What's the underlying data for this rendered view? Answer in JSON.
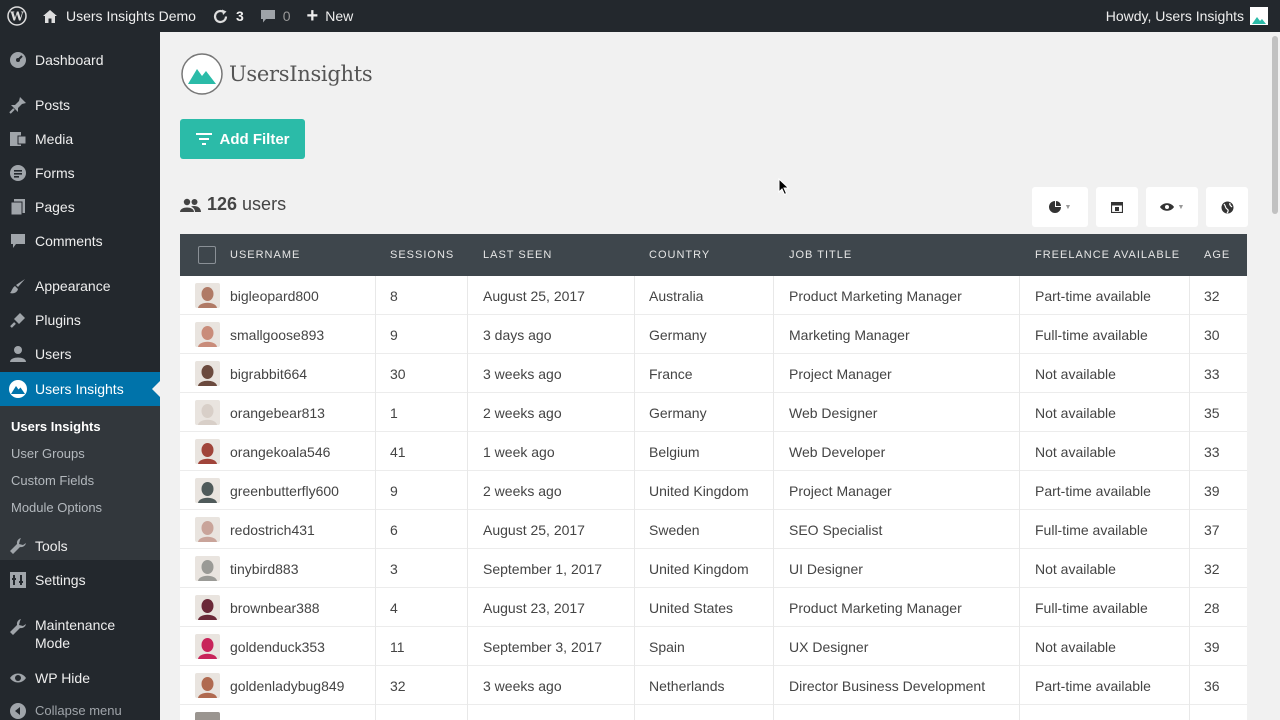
{
  "admin_bar": {
    "site_name": "Users Insights Demo",
    "updates_count": "3",
    "comments_count": "0",
    "new_label": "New",
    "greeting": "Howdy, Users Insights"
  },
  "sidebar": {
    "items": [
      {
        "label": "Dashboard",
        "icon": "dashboard-icon"
      },
      {
        "label": "Posts",
        "icon": "pin-icon"
      },
      {
        "label": "Media",
        "icon": "media-icon"
      },
      {
        "label": "Forms",
        "icon": "forms-icon"
      },
      {
        "label": "Pages",
        "icon": "pages-icon"
      },
      {
        "label": "Comments",
        "icon": "comment-icon"
      },
      {
        "label": "Appearance",
        "icon": "brush-icon"
      },
      {
        "label": "Plugins",
        "icon": "plug-icon"
      },
      {
        "label": "Users",
        "icon": "user-icon"
      },
      {
        "label": "Users Insights",
        "icon": "mountain-icon"
      },
      {
        "label": "Tools",
        "icon": "wrench-icon"
      },
      {
        "label": "Settings",
        "icon": "settings-icon"
      },
      {
        "label": "Maintenance Mode",
        "icon": "wrench-icon"
      },
      {
        "label": "WP Hide",
        "icon": "eye-icon"
      },
      {
        "label": "Collapse menu",
        "icon": "collapse-icon"
      }
    ],
    "submenu": [
      "Users Insights",
      "User Groups",
      "Custom Fields",
      "Module Options"
    ]
  },
  "main": {
    "logo_text": "UsersInsights",
    "add_filter_label": "Add Filter",
    "users_count": "126",
    "users_label": "users"
  },
  "table": {
    "columns": [
      "USERNAME",
      "SESSIONS",
      "LAST SEEN",
      "COUNTRY",
      "JOB TITLE",
      "FREELANCE AVAILABLE",
      "AGE"
    ],
    "rows": [
      {
        "username": "bigleopard800",
        "sessions": "8",
        "last_seen": "August 25, 2017",
        "country": "Australia",
        "job": "Product Marketing Manager",
        "freelance": "Part-time available",
        "age": "32",
        "avatar": "#b07a66"
      },
      {
        "username": "smallgoose893",
        "sessions": "9",
        "last_seen": "3 days ago",
        "country": "Germany",
        "job": "Marketing Manager",
        "freelance": "Full-time available",
        "age": "30",
        "avatar": "#c98c7a"
      },
      {
        "username": "bigrabbit664",
        "sessions": "30",
        "last_seen": "3 weeks ago",
        "country": "France",
        "job": "Project Manager",
        "freelance": "Not available",
        "age": "33",
        "avatar": "#6b4a3e"
      },
      {
        "username": "orangebear813",
        "sessions": "1",
        "last_seen": "2 weeks ago",
        "country": "Germany",
        "job": "Web Designer",
        "freelance": "Not available",
        "age": "35",
        "avatar": "#d8cfc8"
      },
      {
        "username": "orangekoala546",
        "sessions": "41",
        "last_seen": "1 week ago",
        "country": "Belgium",
        "job": "Web Developer",
        "freelance": "Not available",
        "age": "33",
        "avatar": "#a0443a"
      },
      {
        "username": "greenbutterfly600",
        "sessions": "9",
        "last_seen": "2 weeks ago",
        "country": "United Kingdom",
        "job": "Project Manager",
        "freelance": "Part-time available",
        "age": "39",
        "avatar": "#4f5a5a"
      },
      {
        "username": "redostrich431",
        "sessions": "6",
        "last_seen": "August 25, 2017",
        "country": "Sweden",
        "job": "SEO Specialist",
        "freelance": "Full-time available",
        "age": "37",
        "avatar": "#c9a49a"
      },
      {
        "username": "tinybird883",
        "sessions": "3",
        "last_seen": "September 1, 2017",
        "country": "United Kingdom",
        "job": "UI Designer",
        "freelance": "Not available",
        "age": "32",
        "avatar": "#9a9a96"
      },
      {
        "username": "brownbear388",
        "sessions": "4",
        "last_seen": "August 23, 2017",
        "country": "United States",
        "job": "Product Marketing Manager",
        "freelance": "Full-time available",
        "age": "28",
        "avatar": "#6a2838"
      },
      {
        "username": "goldenduck353",
        "sessions": "11",
        "last_seen": "September 3, 2017",
        "country": "Spain",
        "job": "UX Designer",
        "freelance": "Not available",
        "age": "39",
        "avatar": "#c8245a"
      },
      {
        "username": "goldenladybug849",
        "sessions": "32",
        "last_seen": "3 weeks ago",
        "country": "Netherlands",
        "job": "Director Business Development",
        "freelance": "Part-time available",
        "age": "36",
        "avatar": "#b06a50"
      }
    ]
  },
  "colors": {
    "admin_bg": "#23282d",
    "active_menu": "#0073aa",
    "accent": "#2bbba8",
    "table_header": "#3e464c"
  }
}
